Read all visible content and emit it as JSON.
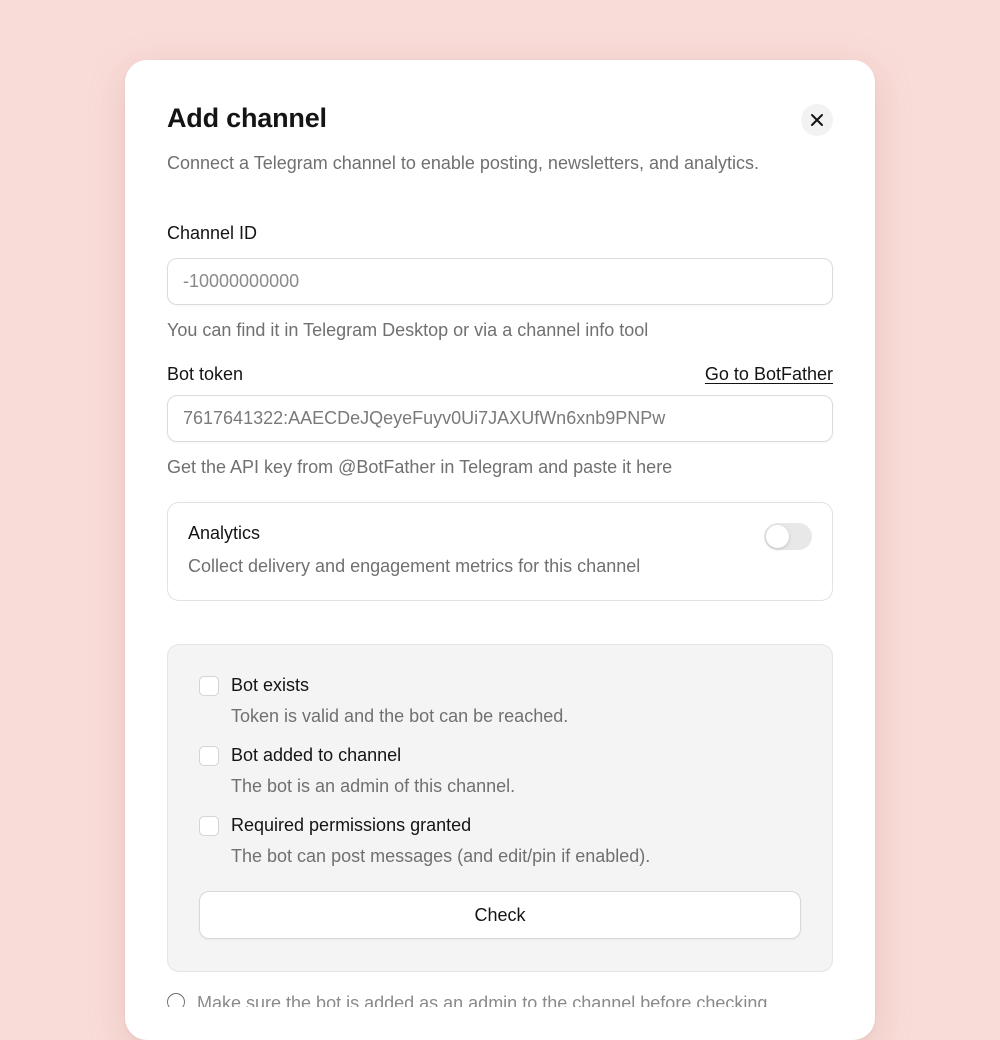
{
  "dialog": {
    "title": "Add channel",
    "subtitle": "Connect a Telegram channel to enable posting, newsletters, and analytics.",
    "close_icon": "close-icon"
  },
  "channel_id": {
    "label": "Channel ID",
    "placeholder": "-10000000000",
    "value": "",
    "hint": "You can find it in Telegram Desktop or via a channel info tool"
  },
  "bot_token": {
    "label": "Bot token",
    "link_label": "Go to BotFather",
    "value": "7617641322:AAECDeJQeyeFuyv0Ui7JAXUfWn6xnb9PNPw",
    "hint": "Get the API key from @BotFather in Telegram and paste it here"
  },
  "analytics": {
    "title": "Analytics",
    "description": "Collect delivery and engagement metrics for this channel",
    "enabled": false
  },
  "checks": {
    "items": [
      {
        "label": "Bot exists",
        "description": "Token is valid and the bot can be reached.",
        "checked": false
      },
      {
        "label": "Bot added to channel",
        "description": "The bot is an admin of this channel.",
        "checked": false
      },
      {
        "label": "Required permissions granted",
        "description": "The bot can post messages (and edit/pin if enabled).",
        "checked": false
      }
    ],
    "button_label": "Check"
  },
  "footer": {
    "note": "Make sure the bot is added as an admin to the channel before checking."
  },
  "colors": {
    "page_background": "#f9dcd8",
    "card_background": "#ffffff",
    "panel_background": "#f4f4f4",
    "text_primary": "#141414",
    "text_secondary": "#707070"
  }
}
